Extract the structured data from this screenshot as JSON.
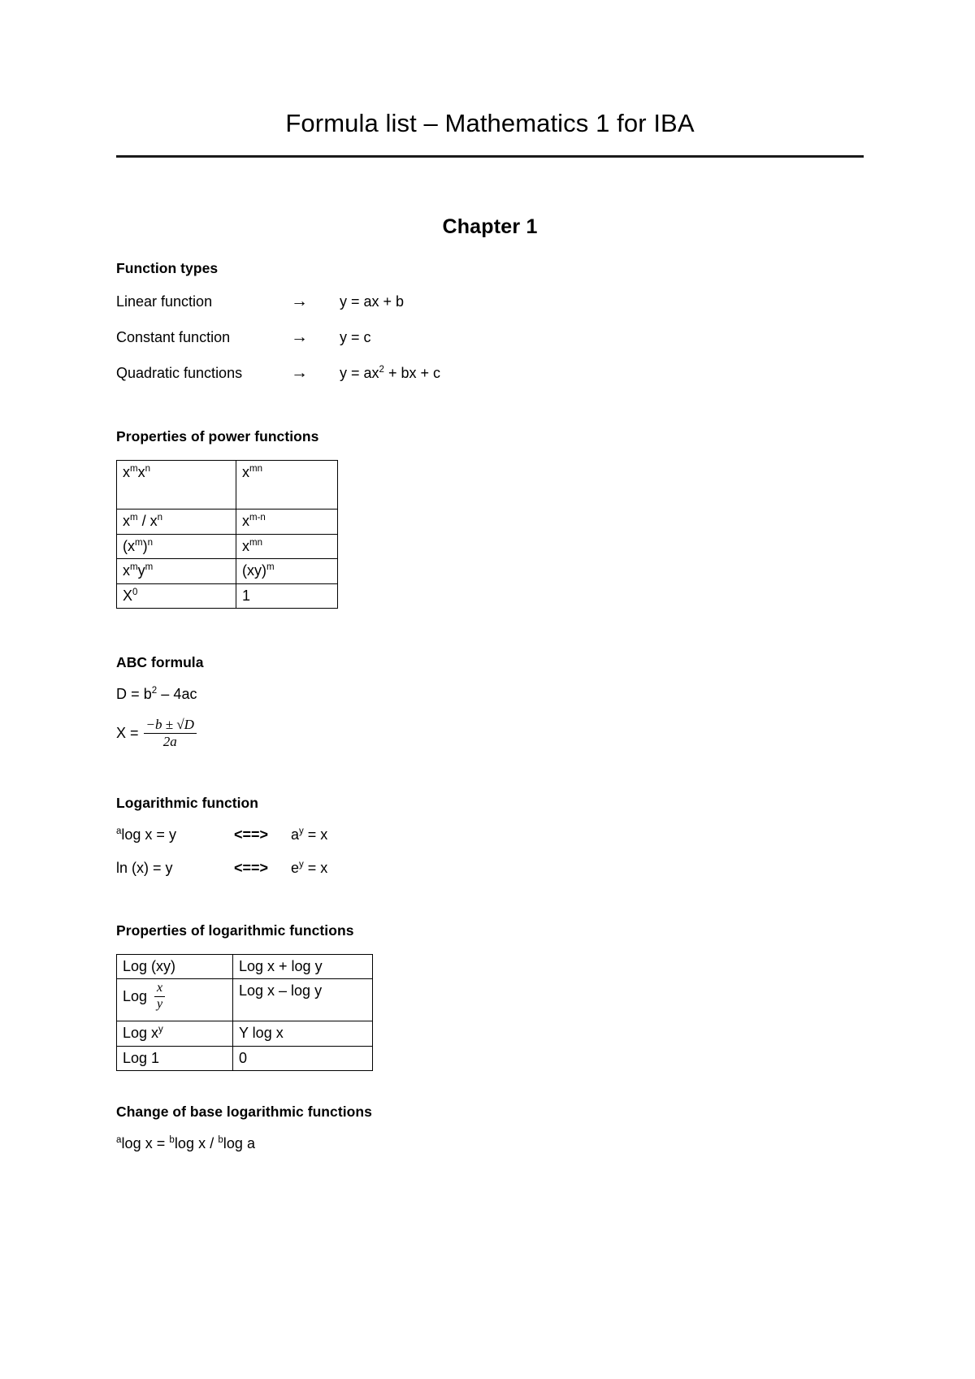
{
  "document": {
    "title": "Formula list – Mathematics 1 for IBA",
    "chapter_heading": "Chapter 1"
  },
  "sections": {
    "function_types": {
      "heading": "Function types",
      "arrow_glyph": "→",
      "rows": [
        {
          "name": "Linear function",
          "arrow": "→",
          "formula_prefix": "y = ax + b",
          "formula_sup": "",
          "formula_suffix": ""
        },
        {
          "name": "Constant function",
          "arrow": "→",
          "formula_prefix": "y = c",
          "formula_sup": "",
          "formula_suffix": ""
        },
        {
          "name": "Quadratic functions",
          "arrow": "→",
          "formula_prefix": "y = ax",
          "formula_sup": "2",
          "formula_suffix": " + bx + c"
        }
      ]
    },
    "power_functions": {
      "heading": "Properties of power functions",
      "rows": [
        {
          "left_base": "x",
          "left_sup": "m",
          "left_base2": "x",
          "left_sup2": "n",
          "left_text": "",
          "right_base": "x",
          "right_sup": "mn"
        },
        {
          "left_base": "x",
          "left_sup": "m",
          "left_base2": "x",
          "left_sup2": "n",
          "left_text": " / ",
          "right_base": "x",
          "right_sup": "m-n"
        },
        {
          "left_base": "(x",
          "left_sup": "m",
          "left_base2": ")",
          "left_sup2": "n",
          "left_text": "",
          "right_base": "x",
          "right_sup": "mn"
        },
        {
          "left_base": "x",
          "left_sup": "m",
          "left_base2": "y",
          "left_sup2": "m",
          "left_text": "",
          "right_base": "(xy)",
          "right_sup": "m"
        },
        {
          "left_base": "X",
          "left_sup": "0",
          "left_base2": "",
          "left_sup2": "",
          "left_text": "",
          "right_base": "1",
          "right_sup": ""
        }
      ]
    },
    "abc_formula": {
      "heading": "ABC formula",
      "discriminant_prefix": "D = b",
      "discriminant_sup": "2",
      "discriminant_suffix": " – 4ac",
      "solution_lhs": "X =",
      "solution_numerator": "−b ± √D",
      "solution_denominator": "2a"
    },
    "logarithmic_function": {
      "heading": "Logarithmic function",
      "rows": [
        {
          "left_sup": "a",
          "left_text": "log x = y",
          "middle": "<==>",
          "right_base": "a",
          "right_sup": "y",
          "right_suffix": " = x"
        },
        {
          "left_sup": "",
          "left_text": "ln (x) = y",
          "middle": "<==>",
          "right_base": "e",
          "right_sup": "y",
          "right_suffix": " = x"
        }
      ]
    },
    "log_properties": {
      "heading": "Properties of logarithmic functions",
      "rows": [
        {
          "left_text": "Log (xy)",
          "left_sup": "",
          "left_frac_num": "",
          "left_frac_den": "",
          "right_text": "Log x + log y"
        },
        {
          "left_text": "Log",
          "left_sup": "",
          "left_frac_num": "x",
          "left_frac_den": "y",
          "right_text": "Log x – log y"
        },
        {
          "left_text": "Log x",
          "left_sup": "y",
          "left_frac_num": "",
          "left_frac_den": "",
          "right_text": "Y log x"
        },
        {
          "left_text": "Log 1",
          "left_sup": "",
          "left_frac_num": "",
          "left_frac_den": "",
          "right_text": "0"
        }
      ]
    },
    "change_of_base": {
      "heading": "Change of base logarithmic functions",
      "sup_a": "a",
      "part1": "log x = ",
      "sup_b1": "b",
      "part2": "log x / ",
      "sup_b2": "b",
      "part3": "log a"
    }
  }
}
